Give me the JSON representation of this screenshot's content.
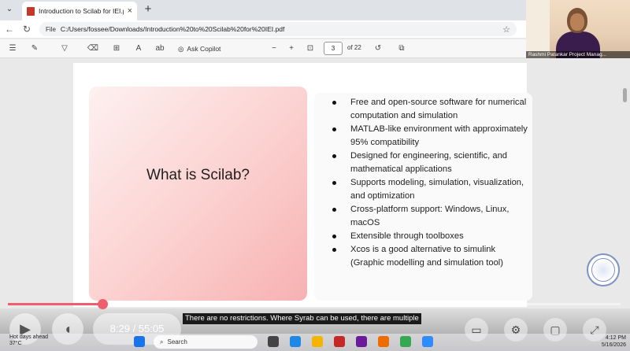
{
  "browser": {
    "tab_title": "Introduction to Scilab for IEI.pdf",
    "tab_close": "×",
    "new_tab": "+",
    "address_label": "File",
    "url": "C:/Users/fossee/Downloads/Introduction%20to%20Scilab%20for%20IEI.pdf"
  },
  "pdf_toolbar": {
    "copilot_label": "Ask Copilot",
    "page_current": "3",
    "page_total_label": "of 22",
    "zoom_out": "−",
    "zoom_in": "+"
  },
  "webcam": {
    "participant_name": "Rashmi Patankar Project Manag..."
  },
  "slide": {
    "title": "What is Scilab?",
    "bullets": [
      "Free and open-source software for numerical computation and simulation",
      "MATLAB-like environment with approximately 95% compatibility",
      "Designed for engineering, scientific, and mathematical applications",
      "Supports modeling, simulation, visualization, and optimization",
      "Cross-platform support: Windows, Linux, macOS",
      "Extensible through toolboxes",
      "Xcos is a good alternative to simulink (Graphic modelling and simulation tool)"
    ]
  },
  "video": {
    "time": "8:29 / 55:05",
    "progress": 0.154,
    "subtitle": "There are no restrictions. Where Syrab can be used, there are multiple",
    "accent_color": "#f05d6d"
  },
  "taskbar": {
    "weather_title": "Hot days ahead",
    "weather_temp": "37°C",
    "search_placeholder": "Search",
    "time": "4:12 PM",
    "date": "5/16/2026"
  },
  "icons": [
    "menu-icon",
    "pdf-icon",
    "back-icon",
    "refresh-icon",
    "star-icon",
    "draw-icon",
    "highlight-icon",
    "eraser-icon",
    "copilot-icon",
    "rotate-icon",
    "play-icon",
    "volume-icon",
    "captions-icon",
    "settings-icon",
    "fullscreen-icon",
    "windows-icon",
    "search-icon"
  ]
}
